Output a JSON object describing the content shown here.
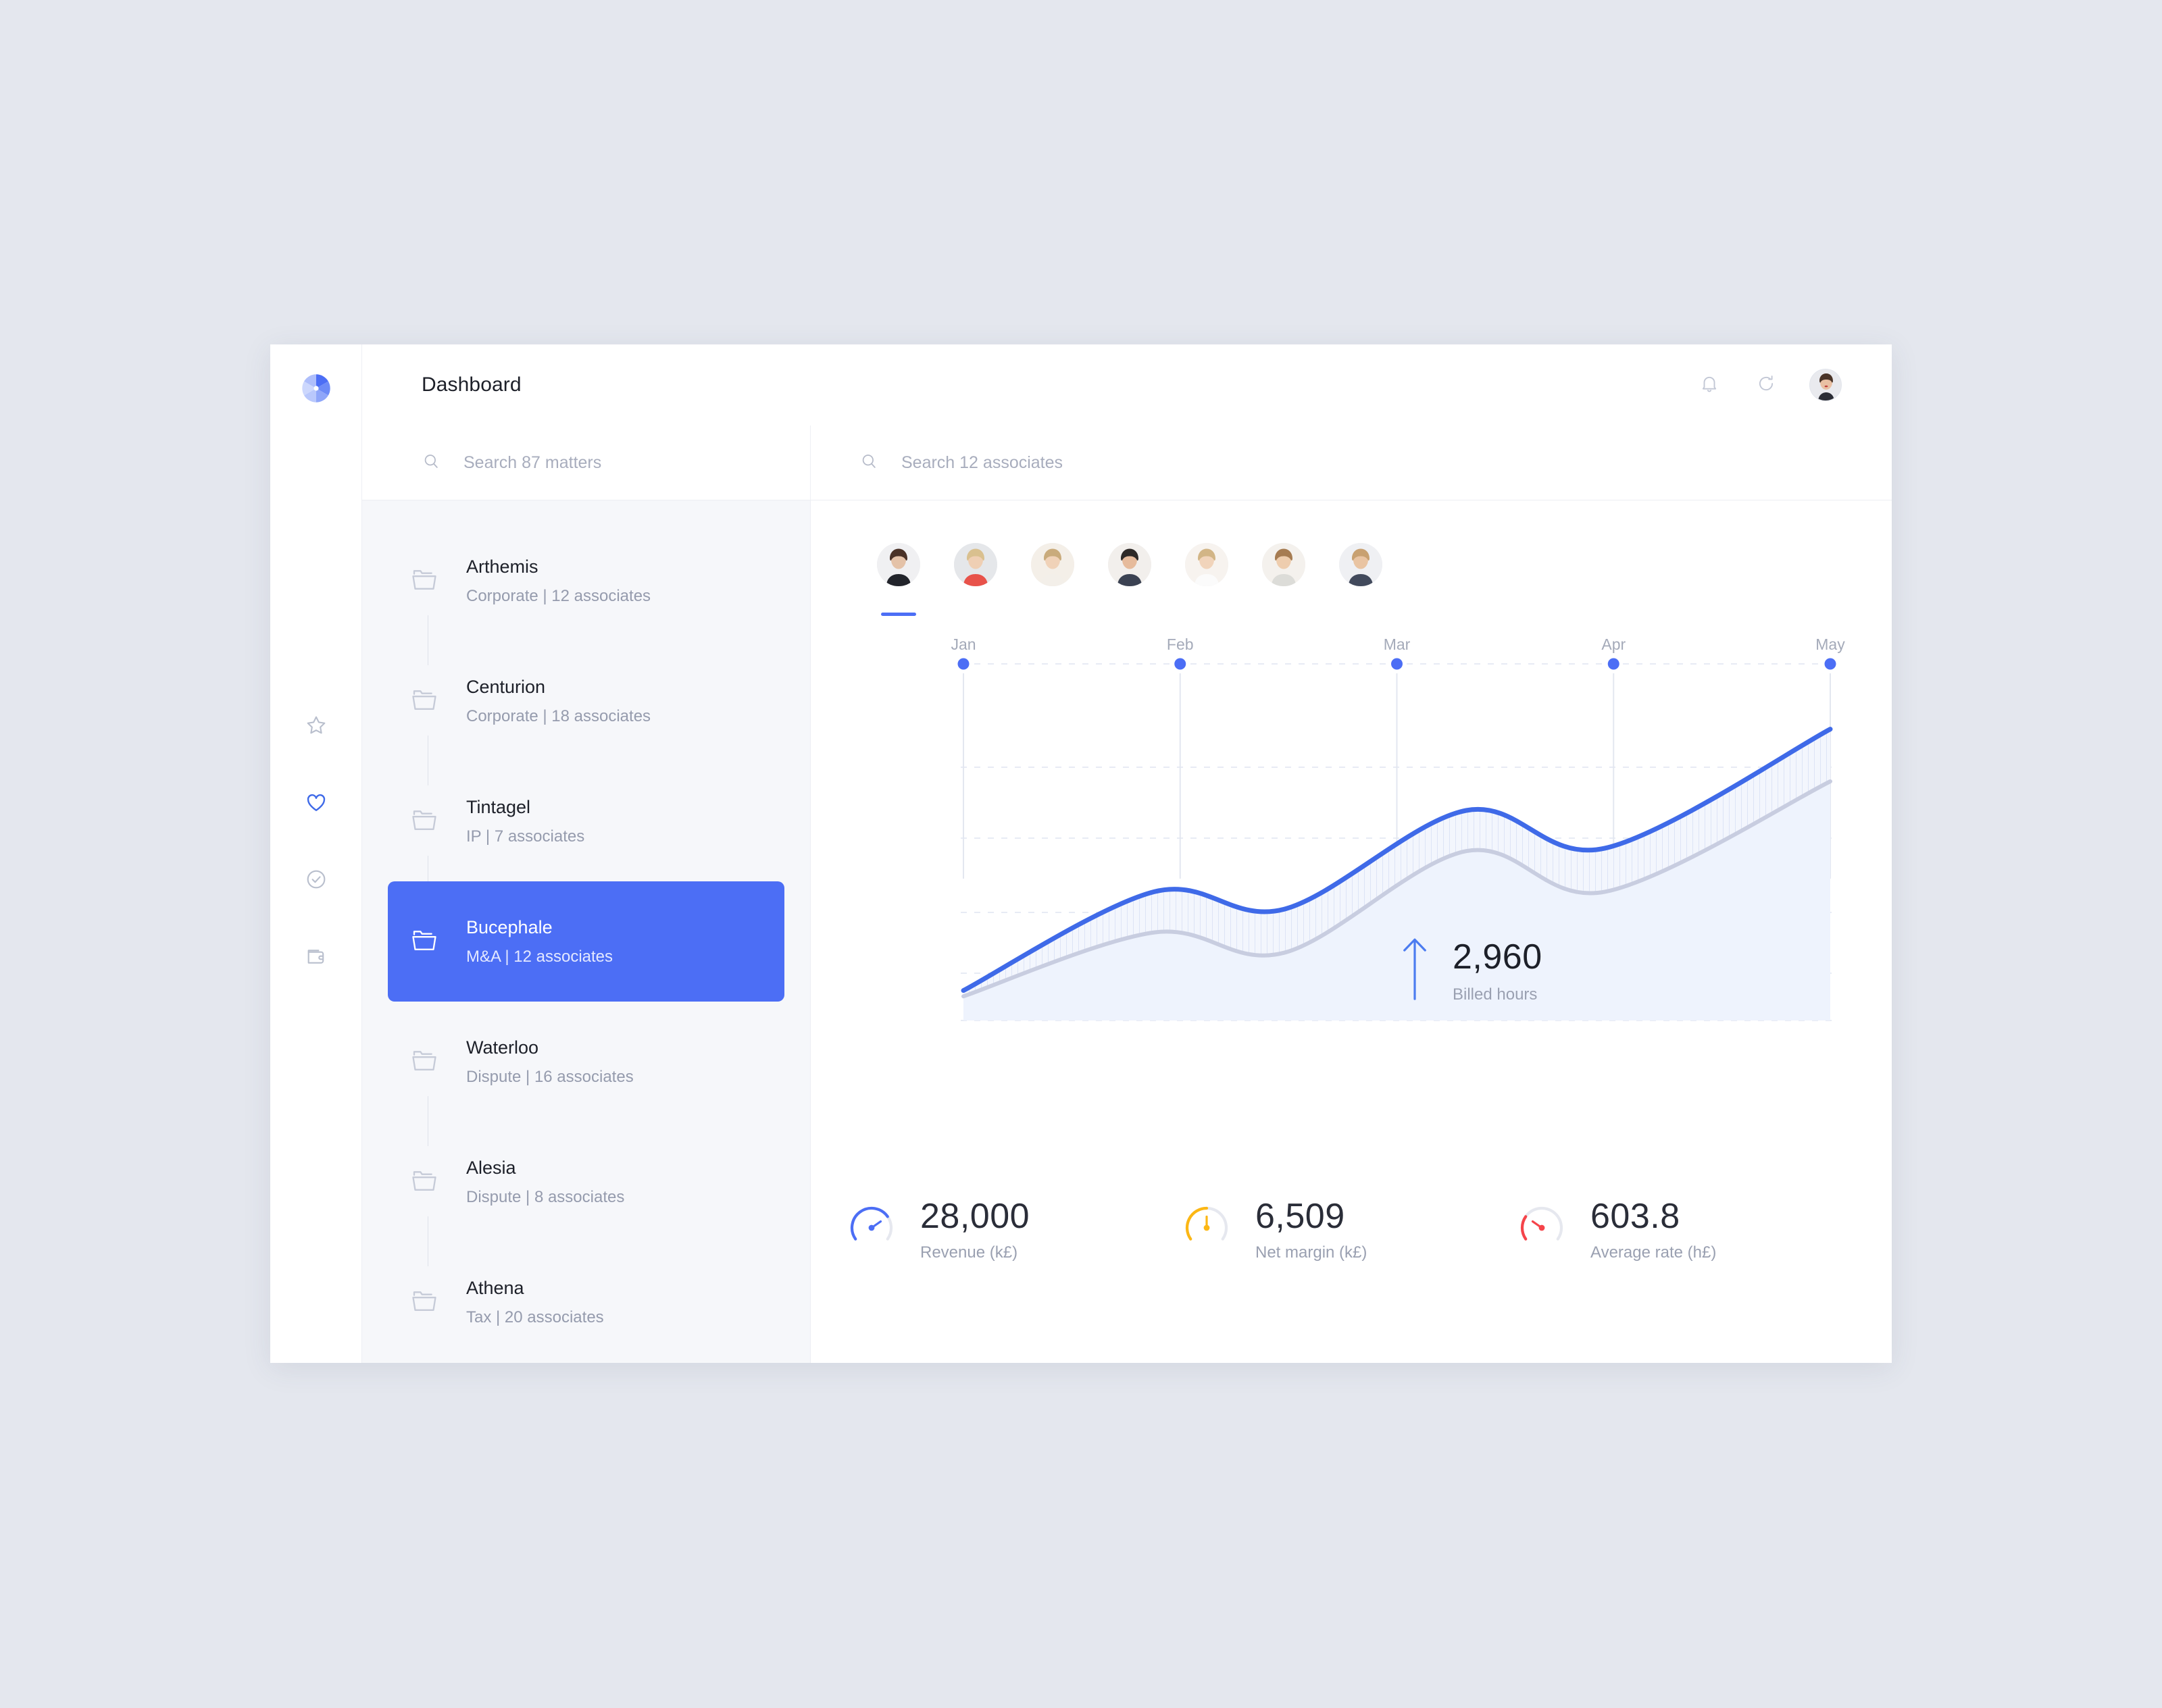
{
  "brand": {
    "logo_icon": "aperture-logo-icon",
    "accent": "#4c6ef5",
    "accent_light": "#7f9bff",
    "accent_pale": "#c5d2ff"
  },
  "rail": {
    "items": [
      {
        "icon": "star-icon",
        "name": "favourites",
        "active": false,
        "color": "#b9bfcd"
      },
      {
        "icon": "heart-icon",
        "name": "liked",
        "active": true,
        "color": "#3f6ae8"
      },
      {
        "icon": "check-circle-icon",
        "name": "tasks",
        "active": false,
        "color": "#b9bfcd"
      },
      {
        "icon": "wallet-icon",
        "name": "billing",
        "active": false,
        "color": "#b9bfcd"
      }
    ]
  },
  "header": {
    "title": "Dashboard",
    "bell_icon": "bell-icon",
    "refresh_icon": "refresh-icon",
    "avatar_icon": "user-avatar"
  },
  "search": {
    "matters": {
      "placeholder": "Search 87 matters",
      "value": "",
      "icon": "search-icon"
    },
    "associates": {
      "placeholder": "Search 12 associates",
      "value": "",
      "icon": "search-icon"
    }
  },
  "matters": {
    "items": [
      {
        "name": "Arthemis",
        "sub": "Corporate | 12 associates",
        "selected": false
      },
      {
        "name": "Centurion",
        "sub": "Corporate | 18 associates",
        "selected": false
      },
      {
        "name": "Tintagel",
        "sub": "IP | 7 associates",
        "selected": false
      },
      {
        "name": "Bucephale",
        "sub": "M&A | 12 associates",
        "selected": true
      },
      {
        "name": "Waterloo",
        "sub": "Dispute | 16 associates",
        "selected": false
      },
      {
        "name": "Alesia",
        "sub": "Dispute | 8 associates",
        "selected": false
      },
      {
        "name": "Athena",
        "sub": "Tax | 20 associates",
        "selected": false
      }
    ]
  },
  "associates": {
    "count": 7,
    "active_index": 0,
    "avatars": [
      {
        "name": "associate-avatar-1",
        "skin": "#e4c2a8",
        "hair": "#4a3227",
        "cloth": "#22242b",
        "bg": "#f0f0f2"
      },
      {
        "name": "associate-avatar-2",
        "skin": "#efcfb4",
        "hair": "#d9c08f",
        "cloth": "#e8524a",
        "bg": "#e5e7ea"
      },
      {
        "name": "associate-avatar-3",
        "skin": "#f0d2b8",
        "hair": "#c9ab7c",
        "cloth": "#f3efe9",
        "bg": "#f4efe8"
      },
      {
        "name": "associate-avatar-4",
        "skin": "#e6bb9c",
        "hair": "#2e2a28",
        "cloth": "#3b4252",
        "bg": "#f2efec"
      },
      {
        "name": "associate-avatar-5",
        "skin": "#f1d4bb",
        "hair": "#d2b586",
        "cloth": "#fbfbfb",
        "bg": "#f7f3ef"
      },
      {
        "name": "associate-avatar-6",
        "skin": "#eecdae",
        "hair": "#a67c52",
        "cloth": "#dcdcd8",
        "bg": "#f4f1ed"
      },
      {
        "name": "associate-avatar-7",
        "skin": "#e9c4a2",
        "hair": "#c8a171",
        "cloth": "#424a5c",
        "bg": "#eff0f3"
      }
    ]
  },
  "billed": {
    "value": "2,960",
    "label": "Billed hours",
    "trend_icon": "arrow-up-icon",
    "trend": "up"
  },
  "stats": [
    {
      "value": "28,000",
      "label": "Revenue (k£)",
      "color": "#4c6ef5",
      "percent": 72,
      "icon": "gauge-icon"
    },
    {
      "value": "6,509",
      "label": "Net margin (k£)",
      "color": "#fcb714",
      "percent": 50,
      "icon": "gauge-icon"
    },
    {
      "value": "603.8",
      "label": "Average rate (h£)",
      "color": "#f5444a",
      "percent": 28,
      "icon": "gauge-icon"
    }
  ],
  "chart_data": {
    "type": "area",
    "title": "",
    "xlabel": "",
    "ylabel": "",
    "categories": [
      "Jan",
      "Feb",
      "Mar",
      "Apr",
      "May"
    ],
    "tick_labels": [
      "Jan",
      "Feb",
      "Mar",
      "Apr",
      "May"
    ],
    "grid": true,
    "gridlines_horizontal": 5,
    "legend": "none",
    "ylim": [
      0,
      100
    ],
    "markers": {
      "shape": "dot",
      "color": "#4c6ef5",
      "at_top": true
    },
    "series": [
      {
        "name": "Billed hours (current)",
        "color": "#3f6ae8",
        "values": [
          8,
          42,
          36,
          70,
          57,
          98
        ]
      },
      {
        "name": "Billed hours (previous)",
        "color": "#c8cde0",
        "values": [
          6,
          28,
          21,
          56,
          42,
          80
        ]
      }
    ],
    "x": [
      0,
      0.22,
      0.37,
      0.58,
      0.74,
      1.0
    ]
  }
}
